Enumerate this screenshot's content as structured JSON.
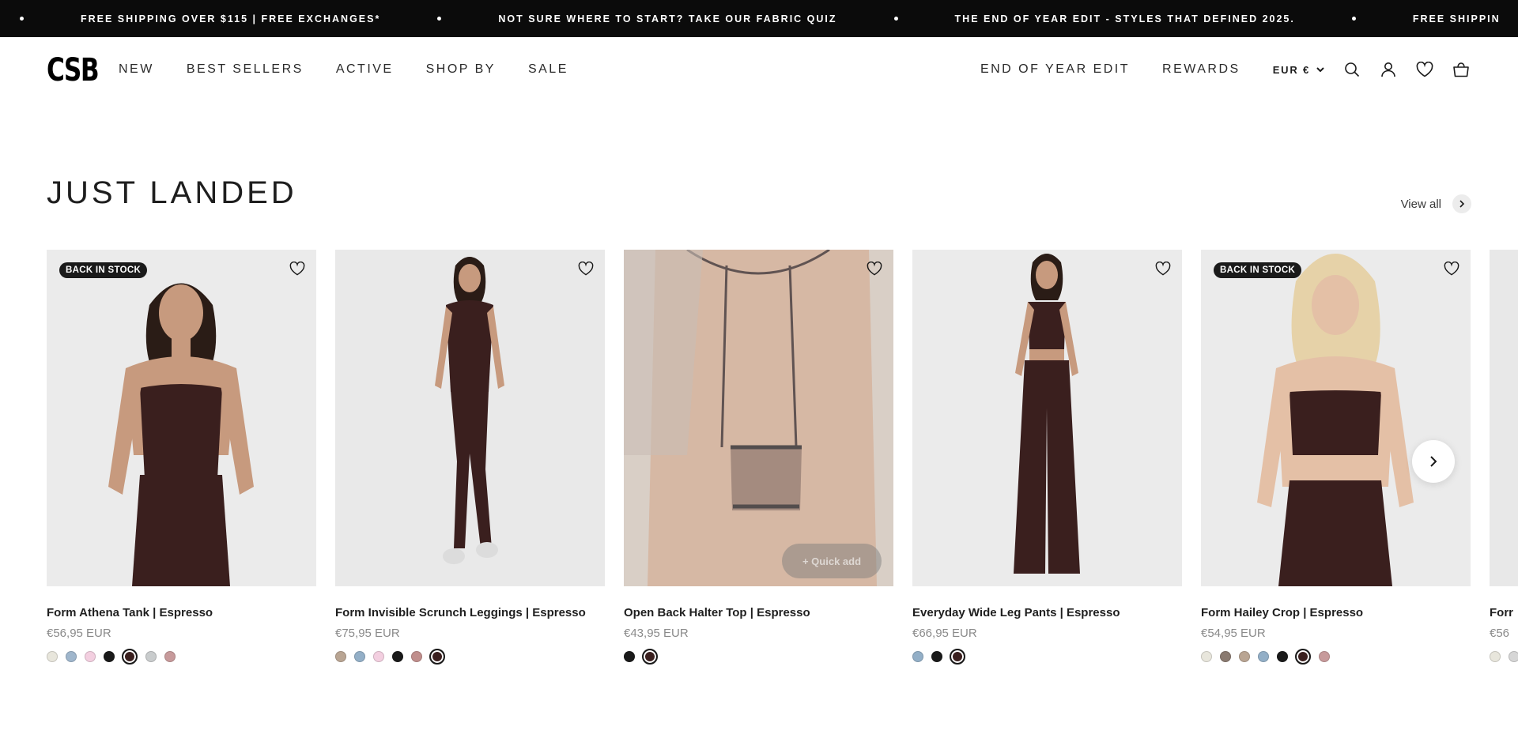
{
  "announcement": {
    "items": [
      "FREE SHIPPING OVER $115 | FREE EXCHANGES*",
      "NOT SURE WHERE TO START? TAKE OUR FABRIC QUIZ",
      "THE END OF YEAR EDIT - STYLES THAT DEFINED 2025.",
      "FREE SHIPPIN"
    ]
  },
  "header": {
    "logo": "CSB",
    "nav_left": [
      "NEW",
      "BEST SELLERS",
      "ACTIVE",
      "SHOP BY",
      "SALE"
    ],
    "nav_right": [
      "END OF YEAR EDIT",
      "REWARDS"
    ],
    "currency": "EUR €",
    "icons": [
      "search-icon",
      "account-icon",
      "wishlist-icon",
      "cart-icon"
    ]
  },
  "section": {
    "title": "JUST LANDED",
    "view_all": "View all"
  },
  "products": [
    {
      "name": "Form Athena Tank | Espresso",
      "price": "€56,95 EUR",
      "badge": "BACK IN STOCK",
      "swatches": [
        "#e8e6dc",
        "#9fb6cc",
        "#f3cfe0",
        "#1a1a1a",
        "#3a1f1e",
        "#c9cccd",
        "#c79a9b"
      ],
      "selected": 4,
      "image_bg": "#ebebeb",
      "model": "standing-tank-set"
    },
    {
      "name": "Form Invisible Scrunch Leggings | Espresso",
      "price": "€75,95 EUR",
      "badge": "",
      "swatches": [
        "#b9a593",
        "#93afc7",
        "#f3cfe0",
        "#1a1a1a",
        "#c08e8c",
        "#3a1f1e"
      ],
      "selected": 5,
      "image_bg": "#e9e9e9",
      "model": "full-body-leggings"
    },
    {
      "name": "Open Back Halter Top | Espresso",
      "price": "€43,95 EUR",
      "badge": "",
      "swatches": [
        "#1a1a1a",
        "#3a1f1e"
      ],
      "selected": 1,
      "image_bg": "#cbbdb2",
      "model": "open-back-halter",
      "quick_add": "+ Quick add"
    },
    {
      "name": "Everyday Wide Leg Pants | Espresso",
      "price": "€66,95 EUR",
      "badge": "",
      "swatches": [
        "#93afc7",
        "#1a1a1a",
        "#3a1f1e"
      ],
      "selected": 2,
      "image_bg": "#ebebeb",
      "model": "wide-leg-pants"
    },
    {
      "name": "Form Hailey Crop | Espresso",
      "price": "€54,95 EUR",
      "badge": "BACK IN STOCK",
      "swatches": [
        "#e8e6dc",
        "#8a7a70",
        "#b9a593",
        "#93afc7",
        "#1a1a1a",
        "#3a1f1e",
        "#c79a9b"
      ],
      "selected": 5,
      "image_bg": "#ebebeb",
      "model": "crop-top-blonde"
    },
    {
      "name": "Forr",
      "price": "€56",
      "badge": "",
      "swatches": [
        "#e8e6dc",
        "#d6d6d6"
      ],
      "selected": -1,
      "image_bg": "#ebebeb",
      "model": "partial"
    }
  ],
  "colors": {
    "espresso": "#3a1f1e",
    "announcement_bg": "#0b0b0b",
    "badge_bg": "#1a1a1a"
  }
}
